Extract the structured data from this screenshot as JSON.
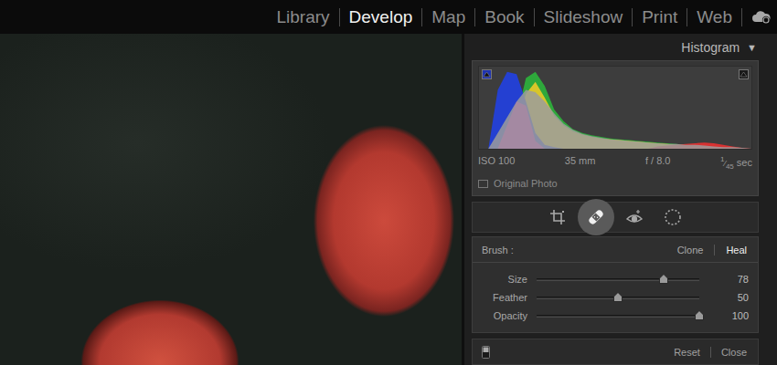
{
  "module_bar": {
    "modules": [
      {
        "label": "Library",
        "selected": false
      },
      {
        "label": "Develop",
        "selected": true
      },
      {
        "label": "Map",
        "selected": false
      },
      {
        "label": "Book",
        "selected": false
      },
      {
        "label": "Slideshow",
        "selected": false
      },
      {
        "label": "Print",
        "selected": false
      },
      {
        "label": "Web",
        "selected": false
      }
    ]
  },
  "histogram": {
    "title": "Histogram",
    "toggle": "▼",
    "clip_indicators": [
      {
        "kind": "shadows",
        "color": "#1f33b0"
      },
      {
        "kind": "highlights",
        "color": "#1a1a1a"
      }
    ],
    "series": [
      {
        "name": "green",
        "color": "#2ea83b",
        "values": [
          0,
          0,
          0,
          0,
          40,
          90,
          98,
          80,
          50,
          35,
          25,
          20,
          17,
          15,
          13,
          12,
          11,
          10,
          9,
          8,
          7,
          6,
          5,
          4,
          4,
          3,
          2,
          1,
          0,
          0
        ]
      },
      {
        "name": "yellow",
        "color": "#d8c62a",
        "values": [
          0,
          0,
          0,
          0,
          20,
          70,
          85,
          65,
          42,
          30,
          22,
          18,
          15,
          13,
          12,
          11,
          10,
          9,
          8,
          7,
          6,
          5,
          5,
          4,
          3,
          3,
          2,
          1,
          0,
          0
        ]
      },
      {
        "name": "red",
        "color": "#d83232",
        "values": [
          0,
          0,
          0,
          0,
          0,
          0,
          0,
          0,
          0,
          0,
          0,
          0,
          0,
          0,
          0,
          0,
          0,
          0,
          0,
          3,
          4,
          5,
          6,
          7,
          8,
          7,
          5,
          3,
          1,
          0
        ]
      },
      {
        "name": "blue",
        "color": "#2440d2",
        "values": [
          0,
          0,
          75,
          98,
          95,
          60,
          20,
          5,
          2,
          0,
          0,
          0,
          0,
          0,
          0,
          0,
          0,
          0,
          0,
          0,
          0,
          0,
          0,
          0,
          0,
          0,
          0,
          0,
          0,
          0
        ]
      },
      {
        "name": "magenta",
        "color": "#d21fc2",
        "values": [
          0,
          0,
          0,
          30,
          60,
          55,
          10,
          0,
          0,
          0,
          0,
          0,
          0,
          0,
          0,
          0,
          0,
          0,
          0,
          0,
          0,
          0,
          0,
          0,
          0,
          0,
          0,
          0,
          0,
          0
        ]
      },
      {
        "name": "luminance",
        "color": "#9c9c9c",
        "values": [
          0,
          0,
          20,
          40,
          60,
          75,
          72,
          60,
          45,
          32,
          24,
          19,
          16,
          14,
          12,
          11,
          10,
          9,
          8,
          7,
          6,
          6,
          5,
          5,
          4,
          3,
          2,
          2,
          1,
          0
        ]
      }
    ],
    "info": {
      "iso": "ISO 100",
      "focal_length": "35 mm",
      "aperture": "f / 8.0",
      "shutter": {
        "numerator": "1",
        "denominator": "45",
        "unit": "sec"
      }
    },
    "original_photo": {
      "label": "Original Photo",
      "checked": false
    }
  },
  "tools": [
    {
      "kind": "crop",
      "selected": false
    },
    {
      "kind": "heal",
      "selected": true
    },
    {
      "kind": "red-eye",
      "selected": false
    },
    {
      "kind": "masking",
      "selected": false
    }
  ],
  "brush": {
    "label": "Brush :",
    "modes": [
      {
        "label": "Clone",
        "selected": false
      },
      {
        "label": "Heal",
        "selected": true
      }
    ],
    "sliders": [
      {
        "label": "Size",
        "value": "78",
        "level": 0.78
      },
      {
        "label": "Feather",
        "value": "50",
        "level": 0.5
      },
      {
        "label": "Opacity",
        "value": "100",
        "level": 1
      }
    ]
  },
  "footer": {
    "enabled": true,
    "buttons": [
      "Reset",
      "Close"
    ]
  }
}
